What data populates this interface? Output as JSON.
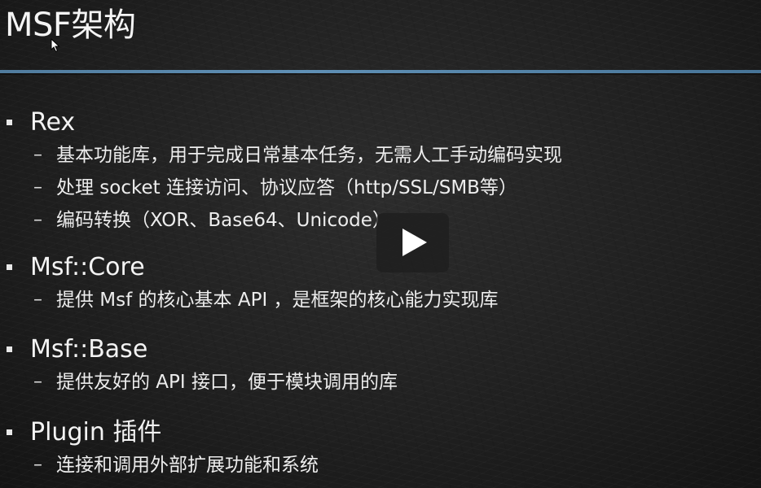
{
  "slide": {
    "title": "MSF架构",
    "sections": [
      {
        "heading": "Rex",
        "items": [
          "基本功能库，用于完成日常基本任务，无需人工手动编码实现",
          "处理 socket 连接访问、协议应答（http/SSL/SMB等）",
          "编码转换（XOR、Base64、Unicode）"
        ]
      },
      {
        "heading": "Msf::Core",
        "items": [
          "提供 Msf 的核心基本 API ，是框架的核心能力实现库"
        ]
      },
      {
        "heading": "Msf::Base",
        "items": [
          "提供友好的 API 接口，便于模块调用的库"
        ]
      },
      {
        "heading": "Plugin 插件",
        "items": [
          "连接和调用外部扩展功能和系统"
        ]
      }
    ],
    "dash": "–"
  },
  "colors": {
    "accent_rule": "#6aa3cf",
    "background": "#222222",
    "text": "#f2f2f2"
  },
  "icons": {
    "play": "play-icon",
    "cursor": "mouse-cursor-icon",
    "bullet": "square-bullet-icon"
  }
}
